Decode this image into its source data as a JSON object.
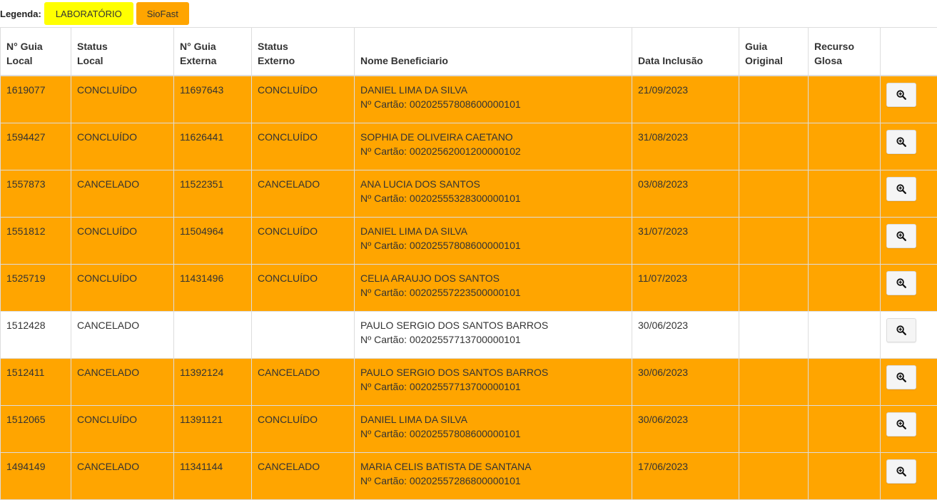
{
  "legend": {
    "label": "Legenda:",
    "items": [
      {
        "label": "LABORATÓRIO",
        "color": "#ffff00"
      },
      {
        "label": "SioFast",
        "color": "#ffa500"
      }
    ]
  },
  "table": {
    "headers": [
      "N° Guia\nLocal",
      "Status\nLocal",
      "N° Guia\nExterna",
      "Status\nExterno",
      "Nome Beneficiario",
      "Data Inclusão",
      "Guia\nOriginal",
      "Recurso\nGlosa",
      ""
    ],
    "rows": [
      {
        "guia_local": "1619077",
        "status_local": "CONCLUÍDO",
        "guia_externa": "11697643",
        "status_externo": "CONCLUÍDO",
        "nome": "DANIEL LIMA DA SILVA",
        "cartao": "Nº Cartão: 00202557808600000101",
        "data": "21/09/2023",
        "color": "orange"
      },
      {
        "guia_local": "1594427",
        "status_local": "CONCLUÍDO",
        "guia_externa": "11626441",
        "status_externo": "CONCLUÍDO",
        "nome": "SOPHIA DE OLIVEIRA CAETANO",
        "cartao": "Nº Cartão: 00202562001200000102",
        "data": "31/08/2023",
        "color": "orange"
      },
      {
        "guia_local": "1557873",
        "status_local": "CANCELADO",
        "guia_externa": "11522351",
        "status_externo": "CANCELADO",
        "nome": "ANA LUCIA DOS SANTOS",
        "cartao": "Nº Cartão: 00202555328300000101",
        "data": "03/08/2023",
        "color": "orange"
      },
      {
        "guia_local": "1551812",
        "status_local": "CONCLUÍDO",
        "guia_externa": "11504964",
        "status_externo": "CONCLUÍDO",
        "nome": "DANIEL LIMA DA SILVA",
        "cartao": "Nº Cartão: 00202557808600000101",
        "data": "31/07/2023",
        "color": "orange"
      },
      {
        "guia_local": "1525719",
        "status_local": "CONCLUÍDO",
        "guia_externa": "11431496",
        "status_externo": "CONCLUÍDO",
        "nome": "CELIA ARAUJO DOS SANTOS",
        "cartao": "Nº Cartão: 00202557223500000101",
        "data": "11/07/2023",
        "color": "orange"
      },
      {
        "guia_local": "1512428",
        "status_local": "CANCELADO",
        "guia_externa": "",
        "status_externo": "",
        "nome": "PAULO SERGIO DOS SANTOS BARROS",
        "cartao": "Nº Cartão: 00202557713700000101",
        "data": "30/06/2023",
        "color": "white"
      },
      {
        "guia_local": "1512411",
        "status_local": "CANCELADO",
        "guia_externa": "11392124",
        "status_externo": "CANCELADO",
        "nome": "PAULO SERGIO DOS SANTOS BARROS",
        "cartao": "Nº Cartão: 00202557713700000101",
        "data": "30/06/2023",
        "color": "orange"
      },
      {
        "guia_local": "1512065",
        "status_local": "CONCLUÍDO",
        "guia_externa": "11391121",
        "status_externo": "CONCLUÍDO",
        "nome": "DANIEL LIMA DA SILVA",
        "cartao": "Nº Cartão: 00202557808600000101",
        "data": "30/06/2023",
        "color": "orange"
      },
      {
        "guia_local": "1494149",
        "status_local": "CANCELADO",
        "guia_externa": "11341144",
        "status_externo": "CANCELADO",
        "nome": "MARIA CELIS BATISTA DE SANTANA",
        "cartao": "Nº Cartão: 00202557286800000101",
        "data": "17/06/2023",
        "color": "orange"
      }
    ],
    "action_icon": "zoom-in-icon"
  }
}
